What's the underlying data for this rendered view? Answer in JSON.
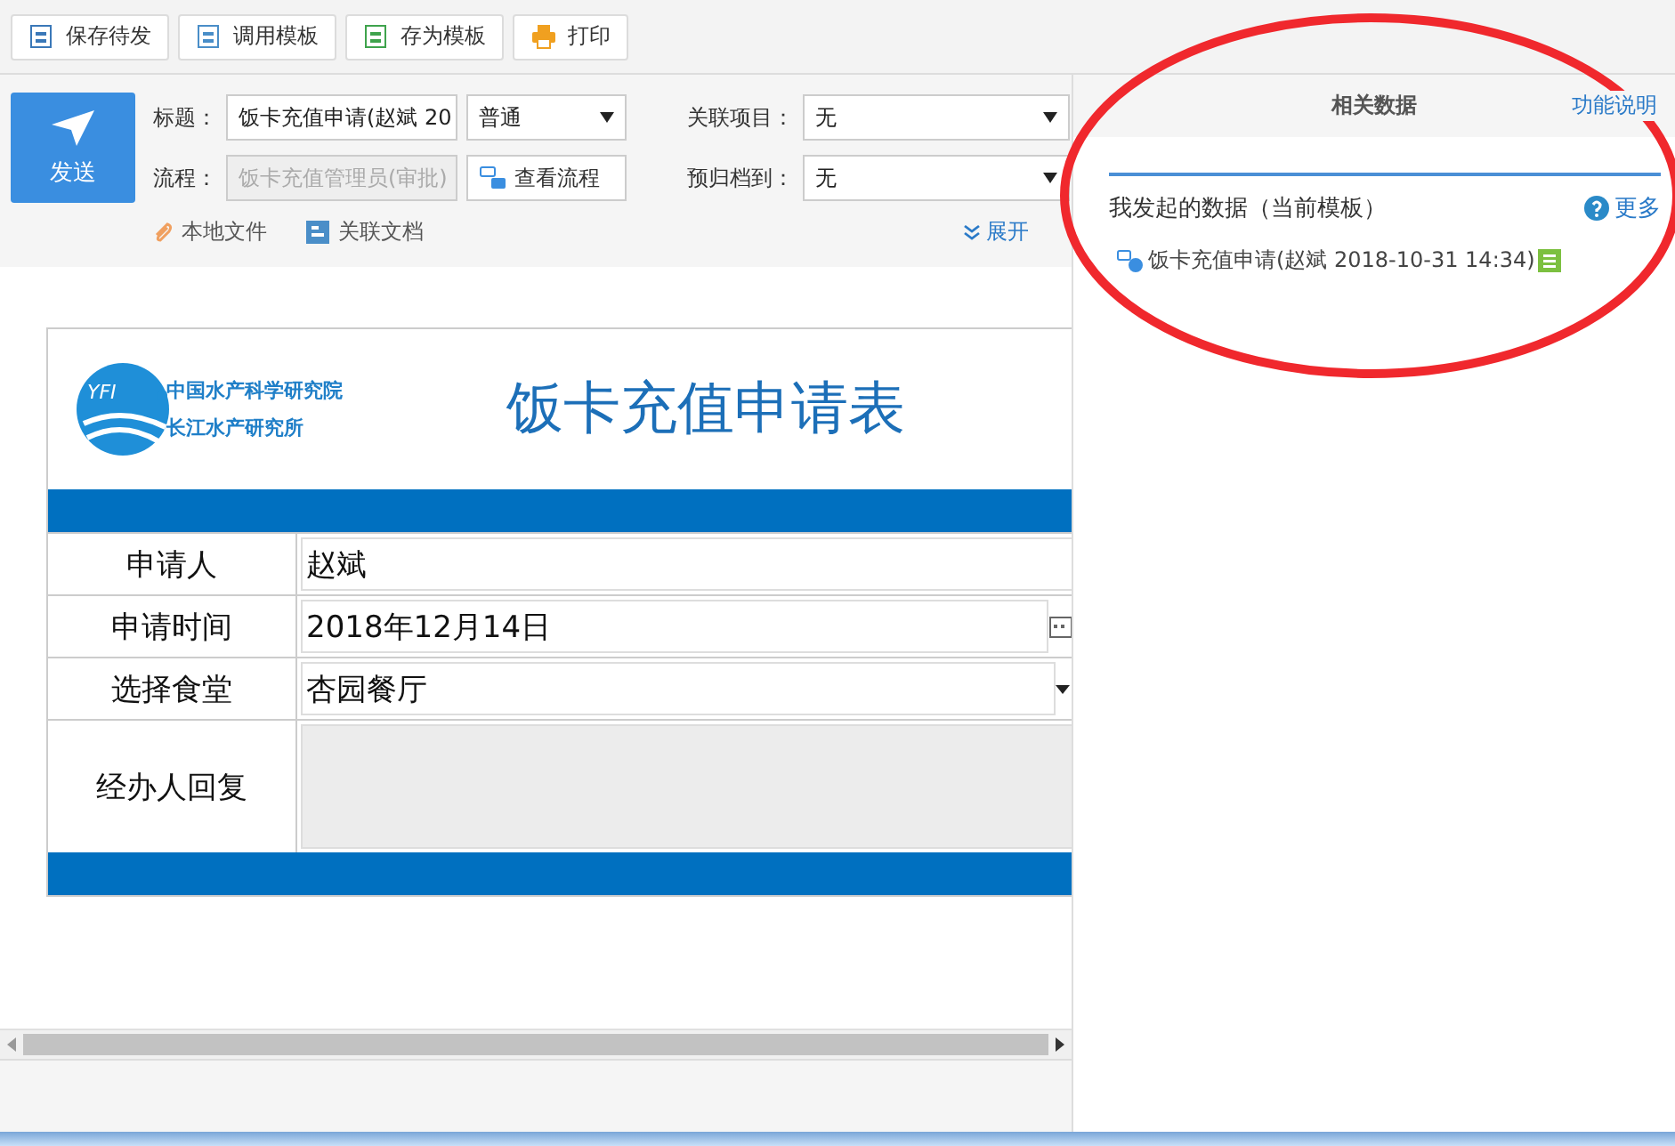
{
  "toolbar": [
    {
      "label": "保存待发",
      "kind": "save"
    },
    {
      "label": "调用模板",
      "kind": "template"
    },
    {
      "label": "存为模板",
      "kind": "saveas"
    },
    {
      "label": "打印",
      "kind": "print"
    }
  ],
  "send_button": "发送",
  "header_fields": {
    "title_label": "标题：",
    "title_value": "饭卡充值申请(赵斌 20",
    "priority": "普通",
    "flow_label": "流程：",
    "flow_value": "饭卡充值管理员(审批)",
    "flow_disabled": true,
    "view_flow": "查看流程",
    "project_label": "关联项目：",
    "project_value": "无",
    "archive_label": "预归档到：",
    "archive_value": "无"
  },
  "attachments": [
    {
      "label": "本地文件",
      "kind": "file"
    },
    {
      "label": "关联文档",
      "kind": "doc"
    }
  ],
  "expand": "展开",
  "form": {
    "logo": {
      "mark": "YFI",
      "line_1": "中国水产科学研究院",
      "line_2": "长江水产研究所"
    },
    "title": "饭卡充值申请表",
    "rows": [
      {
        "label": "申请人",
        "value": "赵斌",
        "kind": "text"
      },
      {
        "label": "申请时间",
        "value": "2018年12月14日",
        "kind": "date"
      },
      {
        "label": "选择食堂",
        "value": "杏园餐厅",
        "kind": "select"
      },
      {
        "label": "经办人回复",
        "kind": "textarea"
      }
    ]
  },
  "side_panel": {
    "header": "相关数据",
    "help_link": "功能说明",
    "section_title": "我发起的数据（当前模板）",
    "more": "更多",
    "items": [
      {
        "text": "饭卡充值申请(赵斌 2018-10-31 14:34)"
      }
    ]
  },
  "annotation": {
    "kind": "ellipse",
    "color": "#f0282d"
  }
}
